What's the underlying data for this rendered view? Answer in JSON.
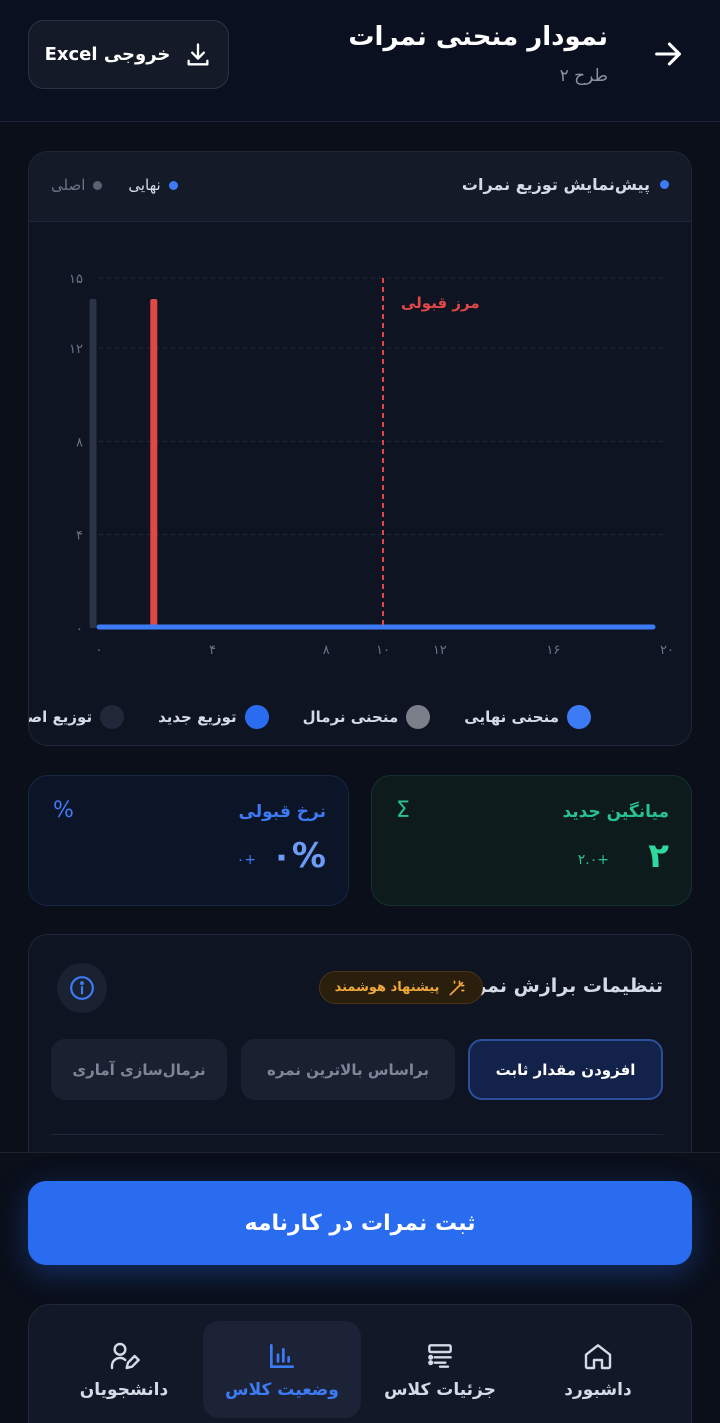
{
  "header": {
    "title": "نمودار منحنی نمرات",
    "subtitle": "طرح ۲",
    "export_label": "خروجی Excel"
  },
  "chart_card": {
    "title": "پیش‌نمایش توزیع نمرات",
    "toggle_final": "نهایی",
    "toggle_original": "اصلی"
  },
  "chart_data": {
    "type": "bar",
    "x_ticks": [
      "۰",
      "۴",
      "۸",
      "۱۰",
      "۱۲",
      "۱۶",
      "۲۰"
    ],
    "x_tick_values": [
      0,
      4,
      8,
      10,
      12,
      16,
      20
    ],
    "y_ticks": [
      "۰",
      "۴",
      "۸",
      "۱۲",
      "۱۵"
    ],
    "y_tick_values": [
      0,
      4,
      8,
      12,
      15
    ],
    "xlim": [
      0,
      20
    ],
    "ylim": [
      0,
      15
    ],
    "grid": true,
    "threshold": {
      "x": 10,
      "label": "مرز قبولی"
    },
    "series": [
      {
        "name": "توزیع اصلی",
        "x": [
          0
        ],
        "values": [
          15
        ]
      },
      {
        "name": "توزیع جدید",
        "x": [
          2
        ],
        "values": [
          15
        ]
      },
      {
        "name": "منحنی نهایی",
        "x": [
          0,
          20
        ],
        "values": [
          0,
          0
        ]
      }
    ],
    "legend": [
      "منحنی نهایی",
      "منحنی نرمال",
      "توزیع جدید",
      "توزیع اصلی"
    ]
  },
  "colors": {
    "accent": "#2a6cf0",
    "final_curve": "#3d7bf5",
    "normal_curve": "#7a7f8a",
    "new_distribution": "#e04848",
    "original_distribution": "#2b3346",
    "threshold": "#e04848",
    "green": "#27c28f",
    "warning": "#f2a93b"
  },
  "stats": {
    "avg_label": "میانگین جدید",
    "avg_value": "۲",
    "avg_delta": "+۲.۰",
    "avg_icon": "sigma-icon",
    "pass_label": "نرخ قبولی",
    "pass_value": "۰%",
    "pass_delta": "+۰",
    "pass_icon": "percent-icon"
  },
  "settings": {
    "title": "تنظیمات برازش نمره",
    "smart_label": "پیشنهاد هوشمند",
    "methods": [
      "افزودن مقدار ثابت",
      "براساس بالاترین نمره",
      "نرمال‌سازی آماری"
    ]
  },
  "submit_label": "ثبت نمرات در کارنامه",
  "nav": {
    "items": [
      {
        "label": "داشبورد",
        "icon": "home-icon"
      },
      {
        "label": "جزئیات کلاس",
        "icon": "class-details-icon"
      },
      {
        "label": "وضعیت کلاس",
        "icon": "bar-chart-icon"
      },
      {
        "label": "دانشجویان",
        "icon": "students-icon"
      }
    ]
  }
}
